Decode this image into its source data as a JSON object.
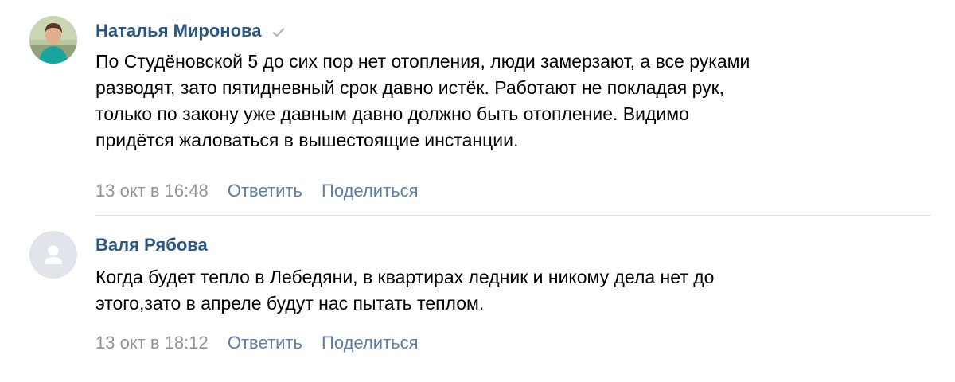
{
  "comments": [
    {
      "author": "Наталья Миронова",
      "verified": true,
      "text_lines": [
        "По Студёновской 5 до сих пор нет отопления, люди замерзают, а все руками",
        "разводят, зато пятидневный срок давно истёк. Работают не покладая рук,",
        "только по закону уже давным давно должно быть отопление. Видимо",
        "придётся жаловаться в вышестоящие инстанции."
      ],
      "date": "13 окт в 16:48",
      "reply_label": "Ответить",
      "share_label": "Поделиться",
      "avatar_icon": "user-photo-avatar"
    },
    {
      "author": "Валя Рябова",
      "verified": false,
      "text_lines": [
        "Когда будет тепло в Лебедяни, в квартирах ледник и никому дела нет до",
        "этого,зато в апреле будут нас пытать теплом."
      ],
      "date": "13 окт в 18:12",
      "reply_label": "Ответить",
      "share_label": "Поделиться",
      "avatar_icon": "default-user-avatar"
    }
  ],
  "colors": {
    "author": "#2a5885",
    "action": "#5b7fa6",
    "date": "#939393",
    "divider": "#dce1e6",
    "placeholder_avatar_bg": "#e1e5eb",
    "placeholder_avatar_fg": "#ffffff"
  }
}
